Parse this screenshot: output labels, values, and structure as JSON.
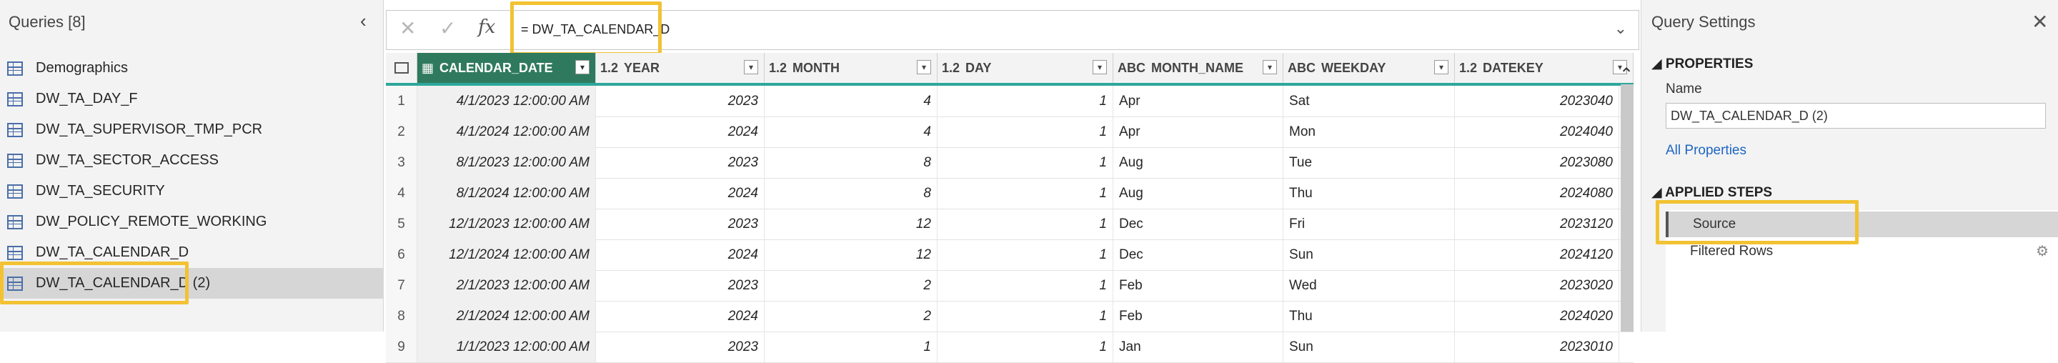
{
  "queries": {
    "header": "Queries [8]",
    "collapse_glyph": "‹",
    "items": [
      {
        "label": "Demographics",
        "icon": "table-icon"
      },
      {
        "label": "DW_TA_DAY_F",
        "icon": "table-icon"
      },
      {
        "label": "DW_TA_SUPERVISOR_TMP_PCR",
        "icon": "table-icon"
      },
      {
        "label": "DW_TA_SECTOR_ACCESS",
        "icon": "table-icon"
      },
      {
        "label": "DW_TA_SECURITY",
        "icon": "table-icon"
      },
      {
        "label": "DW_POLICY_REMOTE_WORKING",
        "icon": "table-question-icon"
      },
      {
        "label": "DW_TA_CALENDAR_D",
        "icon": "table-icon"
      },
      {
        "label": "DW_TA_CALENDAR_D (2)",
        "icon": "table-icon"
      }
    ],
    "selected_index": 7
  },
  "formula_bar": {
    "cancel_glyph": "✕",
    "commit_glyph": "✓",
    "fx_glyph": "fx",
    "text": "= DW_TA_CALENDAR_D",
    "expand_glyph": "⌄"
  },
  "grid": {
    "columns": [
      {
        "type": "calendar-icon",
        "label": "CALENDAR_DATE"
      },
      {
        "type": "1.2",
        "label": "YEAR"
      },
      {
        "type": "1.2",
        "label": "MONTH"
      },
      {
        "type": "1.2",
        "label": "DAY"
      },
      {
        "type": "ABC",
        "label": "MONTH_NAME"
      },
      {
        "type": "ABC",
        "label": "WEEKDAY"
      },
      {
        "type": "1.2",
        "label": "DATEKEY"
      }
    ],
    "rows": [
      {
        "n": "1",
        "date": "4/1/2023 12:00:00 AM",
        "year": "2023",
        "month": "4",
        "day": "1",
        "month_name": "Apr",
        "weekday": "Sat",
        "datekey": "2023040"
      },
      {
        "n": "2",
        "date": "4/1/2024 12:00:00 AM",
        "year": "2024",
        "month": "4",
        "day": "1",
        "month_name": "Apr",
        "weekday": "Mon",
        "datekey": "2024040"
      },
      {
        "n": "3",
        "date": "8/1/2023 12:00:00 AM",
        "year": "2023",
        "month": "8",
        "day": "1",
        "month_name": "Aug",
        "weekday": "Tue",
        "datekey": "2023080"
      },
      {
        "n": "4",
        "date": "8/1/2024 12:00:00 AM",
        "year": "2024",
        "month": "8",
        "day": "1",
        "month_name": "Aug",
        "weekday": "Thu",
        "datekey": "2024080"
      },
      {
        "n": "5",
        "date": "12/1/2023 12:00:00 AM",
        "year": "2023",
        "month": "12",
        "day": "1",
        "month_name": "Dec",
        "weekday": "Fri",
        "datekey": "2023120"
      },
      {
        "n": "6",
        "date": "12/1/2024 12:00:00 AM",
        "year": "2024",
        "month": "12",
        "day": "1",
        "month_name": "Dec",
        "weekday": "Sun",
        "datekey": "2024120"
      },
      {
        "n": "7",
        "date": "2/1/2023 12:00:00 AM",
        "year": "2023",
        "month": "2",
        "day": "1",
        "month_name": "Feb",
        "weekday": "Wed",
        "datekey": "2023020"
      },
      {
        "n": "8",
        "date": "2/1/2024 12:00:00 AM",
        "year": "2024",
        "month": "2",
        "day": "1",
        "month_name": "Feb",
        "weekday": "Thu",
        "datekey": "2024020"
      },
      {
        "n": "9",
        "date": "1/1/2023 12:00:00 AM",
        "year": "2023",
        "month": "1",
        "day": "1",
        "month_name": "Jan",
        "weekday": "Sun",
        "datekey": "2023010"
      }
    ]
  },
  "settings": {
    "title": "Query Settings",
    "close_glyph": "✕",
    "properties_header": "◢ PROPERTIES",
    "name_label": "Name",
    "name_value": "DW_TA_CALENDAR_D (2)",
    "all_properties": "All Properties",
    "applied_steps_header": "◢ APPLIED STEPS",
    "steps": [
      "Source",
      "Filtered Rows"
    ],
    "selected_step": 0
  },
  "colors": {
    "highlight": "#f2c232",
    "header_underline": "#2ea79b",
    "selected_column": "#2f7a5e"
  }
}
